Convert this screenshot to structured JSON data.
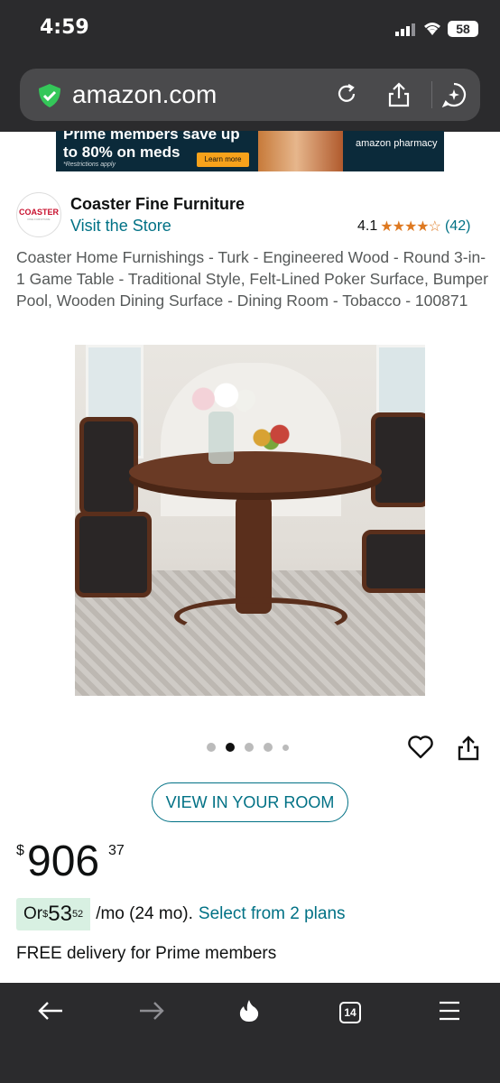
{
  "status_bar": {
    "time": "4:59",
    "battery": "58"
  },
  "browser": {
    "url": "amazon.com",
    "tabs_count": "14"
  },
  "banner": {
    "headline": "Prime members save up to 80% on meds",
    "note": "*Restrictions apply",
    "button": "Learn more",
    "brand": "amazon pharmacy"
  },
  "seller": {
    "logo_text": "COASTER",
    "logo_subtext": "FINE FURNITURE",
    "name": "Coaster Fine Furniture",
    "visit_store": "Visit the Store"
  },
  "rating": {
    "value": "4.1",
    "stars": "★★★★☆",
    "count": "(42)"
  },
  "product": {
    "title": "Coaster Home Furnishings - Turk - Engineered Wood - Round 3-in-1 Game Table - Traditional Style, Felt-Lined Poker Surface, Bumper Pool, Wooden Dining Surface - Dining Room - Tobacco - 100871",
    "image_count": 5,
    "active_image": 2
  },
  "actions": {
    "view_in_room": "VIEW IN YOUR ROOM"
  },
  "price": {
    "symbol": "$",
    "whole": "906",
    "fraction": "37"
  },
  "monthly": {
    "prefix": "Or ",
    "symbol": "$",
    "whole": "53",
    "fraction": "52",
    "suffix": "/mo (24 mo).",
    "plans_link": "Select from 2 plans"
  },
  "delivery": "FREE delivery for Prime members"
}
